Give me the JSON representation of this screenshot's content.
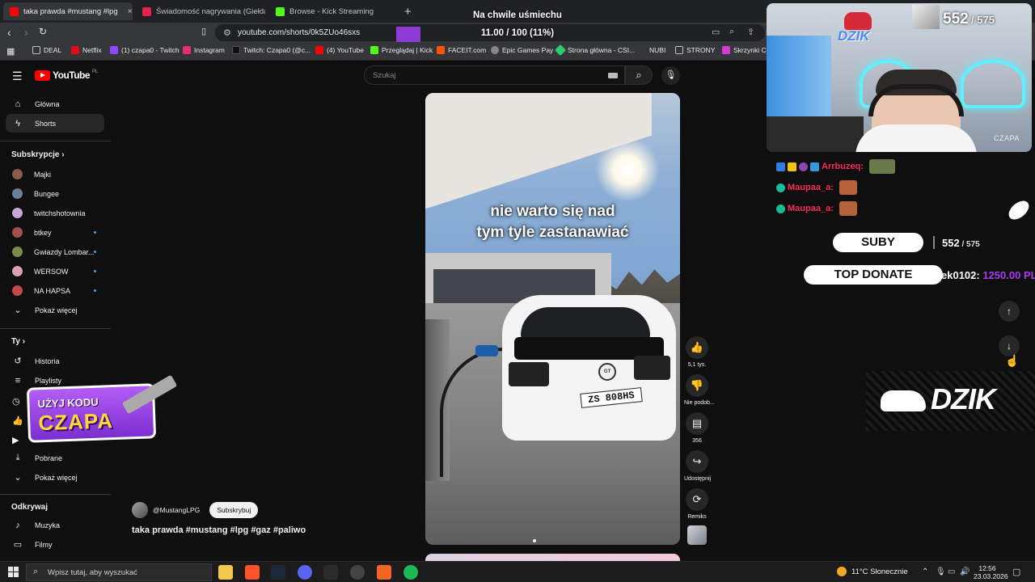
{
  "browser": {
    "tabs": [
      {
        "title": "taka prawda #mustang #lpg",
        "favicon_color": "#ff0000"
      },
      {
        "title": "Świadomość nagrywania (Giełda - Cz",
        "favicon_color": "#e7224a"
      },
      {
        "title": "Browse - Kick Streaming",
        "favicon_color": "#53fc18"
      }
    ],
    "close_glyph": "×",
    "new_tab_glyph": "+",
    "url": "youtube.com/shorts/0k5ZUo46sxs",
    "bookmarks": [
      {
        "label": "DEAL",
        "color": "#bdc1c6"
      },
      {
        "label": "Netflix",
        "color": "#e50914"
      },
      {
        "label": "(1) czapa0 - Twitch",
        "color": "#9146ff"
      },
      {
        "label": "Instagram",
        "color": "#e1306c"
      },
      {
        "label": "Twitch: Czapa0 (@c...",
        "color": "#000000"
      },
      {
        "label": "(4) YouTube",
        "color": "#ff0000"
      },
      {
        "label": "Przeglądaj | Kick",
        "color": "#53fc18"
      },
      {
        "label": "FACEIT.com",
        "color": "#ff5500"
      },
      {
        "label": "Epic Games Pay",
        "color": "#bdc1c6"
      },
      {
        "label": "Strona główna - CSI...",
        "color": "#2ecc71"
      },
      {
        "label": "NUBI",
        "color": "#bdc1c6"
      },
      {
        "label": "STRONY",
        "color": "#bdc1c6"
      },
      {
        "label": "Skrzynki CS",
        "color": "#d63bd6"
      }
    ]
  },
  "youtube": {
    "logo_text": "YouTube",
    "country_code": "PL",
    "search_placeholder": "Szukaj",
    "nav": [
      {
        "label": "Główna",
        "icon": "home-icon",
        "glyph": "⌂"
      },
      {
        "label": "Shorts",
        "icon": "shorts-icon",
        "glyph": "ϟ"
      }
    ],
    "subs_header": "Subskrypcje",
    "subscriptions": [
      {
        "label": "Majki",
        "color": "#8a5a4a",
        "dot": false
      },
      {
        "label": "Bungee",
        "color": "#6b7f9a",
        "dot": false
      },
      {
        "label": "twitchshotownia",
        "color": "#c7a9d8",
        "dot": false
      },
      {
        "label": "btkey",
        "color": "#a0524a",
        "dot": true
      },
      {
        "label": "Gwiazdy Lombar...",
        "color": "#7a8b4a",
        "dot": true
      },
      {
        "label": "WERSOW",
        "color": "#d8a0b0",
        "dot": true
      },
      {
        "label": "NA HAPSA",
        "color": "#c24a4a",
        "dot": true
      }
    ],
    "show_more_1": "Pokaż więcej",
    "you_header": "Ty",
    "you_items": [
      {
        "label": "Historia",
        "glyph": "↺",
        "icon": "history-icon"
      },
      {
        "label": "Playlisty",
        "glyph": "≡",
        "icon": "playlists-icon"
      },
      {
        "label": "Pobrane",
        "glyph": "⤓",
        "icon": "download-icon"
      }
    ],
    "show_more_2": "Pokaż więcej",
    "explore_header": "Odkrywaj",
    "explore_items": [
      {
        "label": "Muzyka",
        "glyph": "♪",
        "icon": "music-icon"
      },
      {
        "label": "Filmy",
        "glyph": "▭",
        "icon": "movies-icon"
      }
    ],
    "video": {
      "caption_line1": "nie warto się nad",
      "caption_line2": "tym tyle zastanawiać",
      "plate": "ZS 808HS",
      "badge": "GT"
    },
    "actions": [
      {
        "label": "5,1 tys.",
        "glyph": "👍",
        "icon": "like-icon"
      },
      {
        "label": "Nie podob...",
        "glyph": "👎",
        "icon": "dislike-icon"
      },
      {
        "label": "356",
        "glyph": "▤",
        "icon": "comments-icon"
      },
      {
        "label": "Udostępnij",
        "glyph": "↪",
        "icon": "share-icon"
      },
      {
        "label": "Remiks",
        "glyph": "⟳",
        "icon": "remix-icon"
      }
    ],
    "channel_name": "@MustangLPG",
    "subscribe_label": "Subskrybuj",
    "video_title": "taka prawda #mustang #lpg #gaz #paliwo",
    "scroll_up_glyph": "↑",
    "scroll_down_glyph": "↓"
  },
  "overlay": {
    "goal_title": "Na chwile uśmiechu",
    "goal_value": "11.00 / 100 (11%)",
    "goal_progress": 0.11,
    "brand_logo_text": "DZIK",
    "sub_current": "552",
    "sub_goal": "575",
    "cam_tag": "CZAPA",
    "chat": [
      {
        "user": "Arrbuzeq:",
        "badges": [
          "#2f7de0",
          "#f1c40f",
          "#8e44ad",
          "#3498db"
        ],
        "emote_color": "#6b7a4a"
      },
      {
        "user": "Maupaa_a:",
        "badges": [
          "#1abc9c"
        ],
        "emote_color": "#b5623a"
      },
      {
        "user": "Maupaa_a:",
        "badges": [
          "#1abc9c"
        ],
        "emote_color": "#b5623a"
      }
    ],
    "suby_label": "SUBY",
    "suby_value": "552",
    "suby_goal": "575",
    "top_donate_label": "TOP DONATE",
    "top_donate_name": "ek0102:",
    "top_donate_amount": "1250.00 PL",
    "banner_text": "DZIK",
    "promo_line1": "UŻYJ KODU",
    "promo_line2": "CZAPA"
  },
  "taskbar": {
    "search_placeholder": "Wpisz tutaj, aby wyszukać",
    "apps": [
      "#f2c94c",
      "#fb542b",
      "#1b2838",
      "#5865f2",
      "#2a2a2a",
      "#444444",
      "#f26522",
      "#1db954"
    ],
    "weather": "11°C  Słonecznie",
    "time": "12:56",
    "date": "23.03.2026"
  }
}
